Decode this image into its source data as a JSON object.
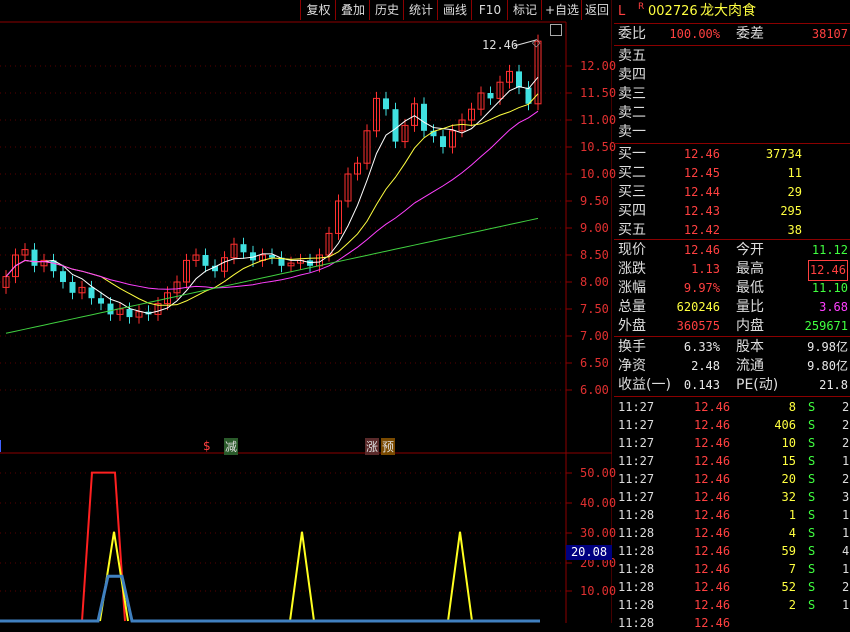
{
  "toolbar": {
    "buttons": [
      "复权",
      "叠加",
      "历史",
      "统计",
      "画线",
      "F10",
      "标记",
      "+自选",
      "返回"
    ]
  },
  "main_chart": {
    "price_labels": [
      "12.00",
      "11.50",
      "11.00",
      "10.50",
      "10.00",
      "9.50",
      "9.00",
      "8.50",
      "8.00",
      "7.50",
      "7.00",
      "6.50",
      "6.00"
    ],
    "high_annotation": "12.46",
    "markers": {
      "sell": "$",
      "reduce": "减",
      "limit": "涨",
      "pre": "预"
    }
  },
  "sub_chart": {
    "labels": [
      "50.00",
      "40.00",
      "30.00",
      "20.00",
      "10.00"
    ],
    "current_value": "20.08"
  },
  "stock": {
    "l_flag": "L",
    "r_flag": "R",
    "code": "002726",
    "name": "龙大肉食"
  },
  "ratio": {
    "label": "委比",
    "value": "100.00%",
    "diff_label": "委差",
    "diff_value": "38107"
  },
  "asks": [
    {
      "label": "卖五",
      "price": "",
      "vol": ""
    },
    {
      "label": "卖四",
      "price": "",
      "vol": ""
    },
    {
      "label": "卖三",
      "price": "",
      "vol": ""
    },
    {
      "label": "卖二",
      "price": "",
      "vol": ""
    },
    {
      "label": "卖一",
      "price": "",
      "vol": ""
    }
  ],
  "bids": [
    {
      "label": "买一",
      "price": "12.46",
      "vol": "37734"
    },
    {
      "label": "买二",
      "price": "12.45",
      "vol": "11"
    },
    {
      "label": "买三",
      "price": "12.44",
      "vol": "29"
    },
    {
      "label": "买四",
      "price": "12.43",
      "vol": "295"
    },
    {
      "label": "买五",
      "price": "12.42",
      "vol": "38"
    }
  ],
  "quote": [
    {
      "l1": "现价",
      "v1": "12.46",
      "l2": "今开",
      "v2": "11.12",
      "c1": "red",
      "c2": "grn"
    },
    {
      "l1": "涨跌",
      "v1": "1.13",
      "l2": "最高",
      "v2": "12.46",
      "c1": "red",
      "c2": "red"
    },
    {
      "l1": "涨幅",
      "v1": "9.97%",
      "l2": "最低",
      "v2": "11.10",
      "c1": "red",
      "c2": "grn"
    },
    {
      "l1": "总量",
      "v1": "620246",
      "l2": "量比",
      "v2": "3.68",
      "c1": "yel",
      "c2": "mag"
    },
    {
      "l1": "外盘",
      "v1": "360575",
      "l2": "内盘",
      "v2": "259671",
      "c1": "red",
      "c2": "grn"
    }
  ],
  "fundamentals": [
    {
      "l1": "换手",
      "v1": "6.33%",
      "l2": "股本",
      "v2": "9.98亿"
    },
    {
      "l1": "净资",
      "v1": "2.48",
      "l2": "流通",
      "v2": "9.80亿"
    },
    {
      "l1": "收益(一)",
      "v1": "0.143",
      "l2": "PE(动)",
      "v2": "21.8"
    }
  ],
  "ticks": [
    {
      "time": "11:27",
      "price": "12.46",
      "vol": "8",
      "side": "S",
      "n": "2"
    },
    {
      "time": "11:27",
      "price": "12.46",
      "vol": "406",
      "side": "S",
      "n": "2"
    },
    {
      "time": "11:27",
      "price": "12.46",
      "vol": "10",
      "side": "S",
      "n": "2"
    },
    {
      "time": "11:27",
      "price": "12.46",
      "vol": "15",
      "side": "S",
      "n": "1"
    },
    {
      "time": "11:27",
      "price": "12.46",
      "vol": "20",
      "side": "S",
      "n": "2"
    },
    {
      "time": "11:27",
      "price": "12.46",
      "vol": "32",
      "side": "S",
      "n": "3"
    },
    {
      "time": "11:28",
      "price": "12.46",
      "vol": "1",
      "side": "S",
      "n": "1"
    },
    {
      "time": "11:28",
      "price": "12.46",
      "vol": "4",
      "side": "S",
      "n": "1"
    },
    {
      "time": "11:28",
      "price": "12.46",
      "vol": "59",
      "side": "S",
      "n": "4"
    },
    {
      "time": "11:28",
      "price": "12.46",
      "vol": "7",
      "side": "S",
      "n": "1"
    },
    {
      "time": "11:28",
      "price": "12.46",
      "vol": "52",
      "side": "S",
      "n": "2"
    },
    {
      "time": "11:28",
      "price": "12.46",
      "vol": "2",
      "side": "S",
      "n": "1"
    },
    {
      "time": "11:28",
      "price": "12.46",
      "vol": "",
      "side": "",
      "n": ""
    }
  ]
}
